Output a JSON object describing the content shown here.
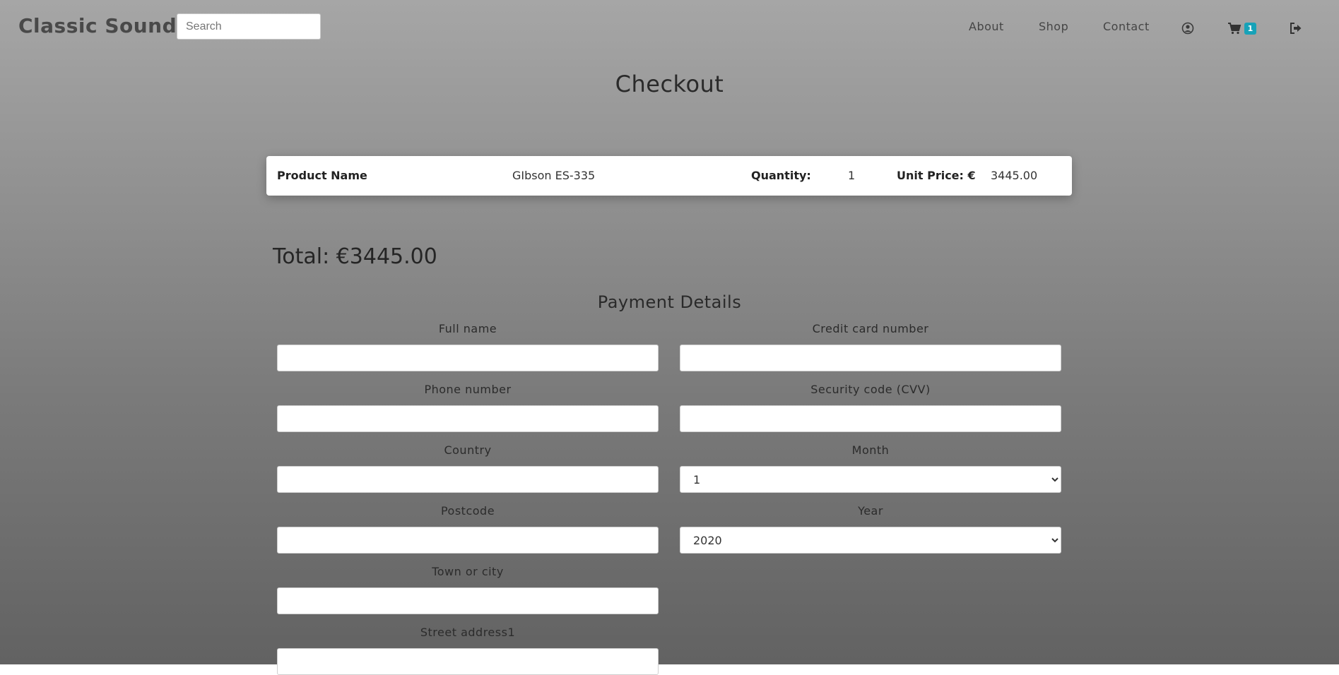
{
  "brand": "Classic Sounds",
  "search": {
    "placeholder": "Search",
    "value": ""
  },
  "nav": {
    "about": "About",
    "shop": "Shop",
    "contact": "Contact",
    "cart_count": "1"
  },
  "page_title": "Checkout",
  "product": {
    "name_label": "Product Name",
    "name": "GIbson ES-335",
    "quantity_label": "Quantity:",
    "quantity": "1",
    "unit_price_label": "Unit Price: €",
    "unit_price": "3445.00"
  },
  "total": "Total: €3445.00",
  "payment": {
    "title": "Payment Details",
    "full_name": {
      "label": "Full name",
      "value": ""
    },
    "credit_card": {
      "label": "Credit card number",
      "value": ""
    },
    "phone": {
      "label": "Phone number",
      "value": ""
    },
    "cvv": {
      "label": "Security code (CVV)",
      "value": ""
    },
    "country": {
      "label": "Country",
      "value": ""
    },
    "month": {
      "label": "Month",
      "selected": "1"
    },
    "postcode": {
      "label": "Postcode",
      "value": ""
    },
    "year": {
      "label": "Year",
      "selected": "2020"
    },
    "town": {
      "label": "Town or city",
      "value": ""
    },
    "street1": {
      "label": "Street address1",
      "value": ""
    }
  },
  "colors": {
    "badge": "#17a2b8",
    "background_top": "#a6a6a6",
    "background_bottom": "#626262"
  },
  "icons": [
    "user-icon",
    "cart-icon",
    "sign-out-icon"
  ]
}
